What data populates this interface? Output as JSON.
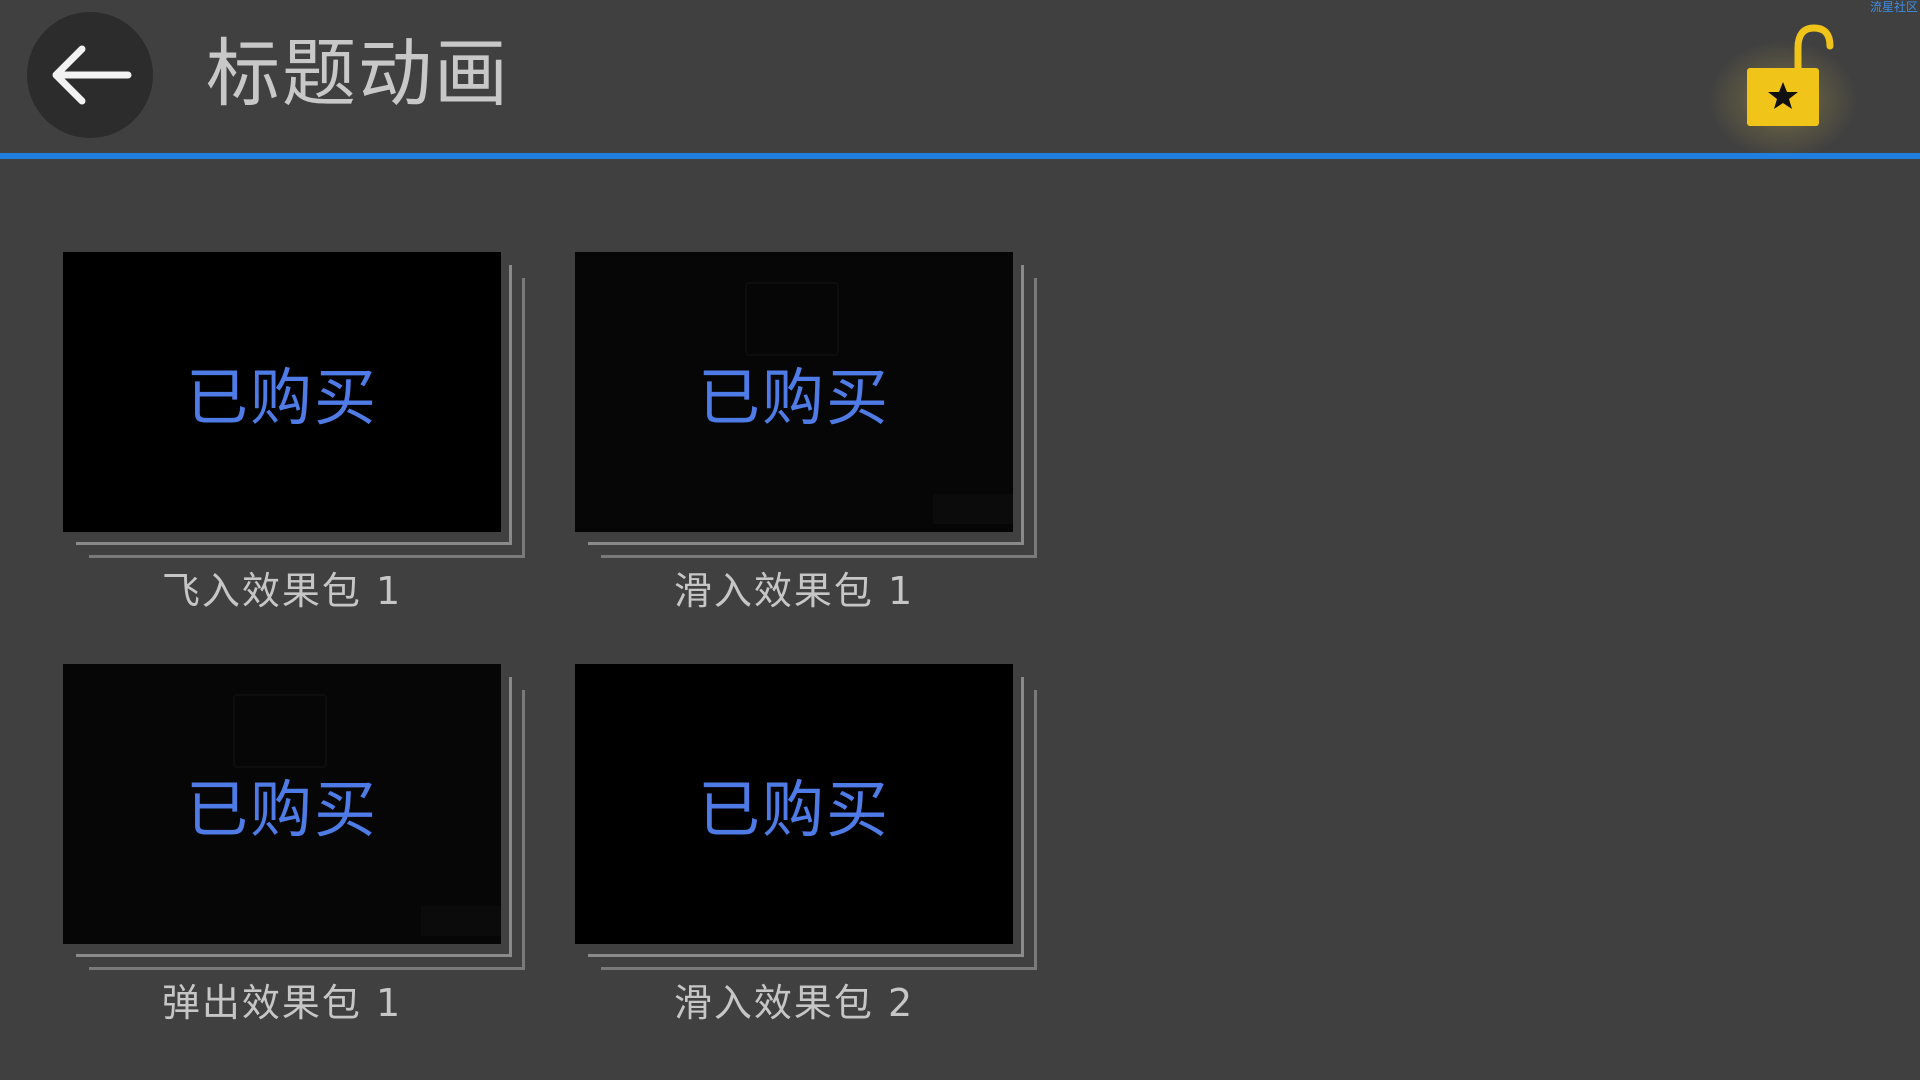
{
  "watermark": "流星社区",
  "header": {
    "back_icon": "arrow-left-icon",
    "title": "标题动画",
    "unlock_icon": "unlock-star-icon",
    "accent_color": "#1f7fe0",
    "lock_color": "#f0c419"
  },
  "cards": [
    {
      "status": "已购买",
      "label": "飞入效果包 1"
    },
    {
      "status": "已购买",
      "label": "滑入效果包 1"
    },
    {
      "status": "已购买",
      "label": "弹出效果包 1"
    },
    {
      "status": "已购买",
      "label": "滑入效果包 2"
    }
  ]
}
